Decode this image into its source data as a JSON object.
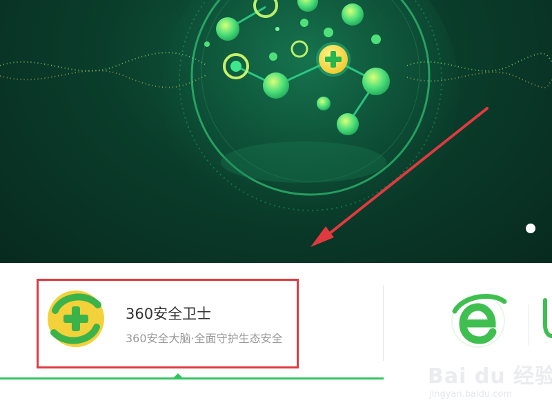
{
  "banner": {
    "carousel_dots": 1
  },
  "products": [
    {
      "name": "360安全卫士",
      "description": "360安全大脑·全面守护生态安全",
      "icon": "360-safe-icon",
      "active": true
    },
    {
      "icon": "360-browser-icon",
      "active": false
    }
  ],
  "watermark": {
    "brand": "Bai du 经验",
    "url": "jingyan.baidu.com"
  },
  "colors": {
    "banner_bg": "#0a3d2b",
    "accent_green": "#2ec55c",
    "annotation_red": "#e03a3f",
    "logo_yellow": "#f3d13a"
  }
}
